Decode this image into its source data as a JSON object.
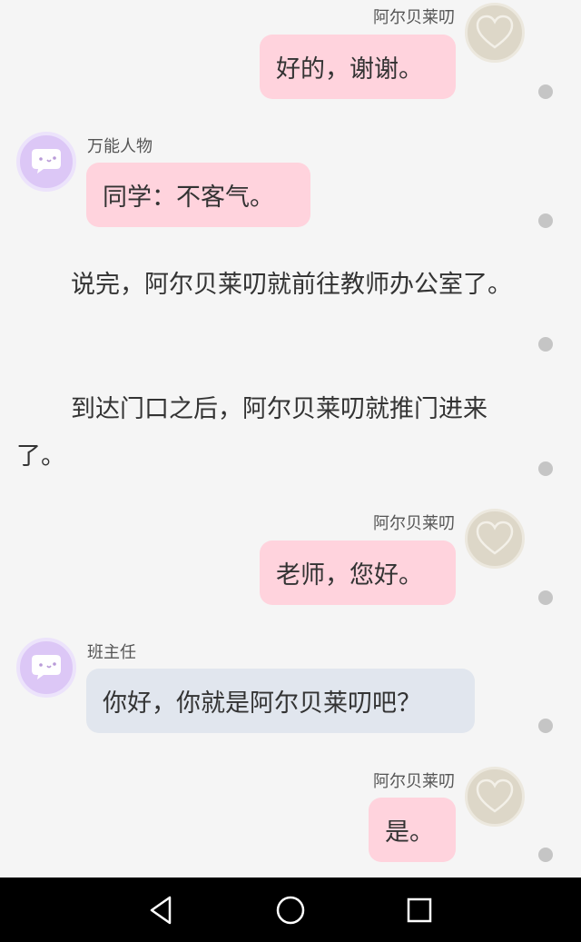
{
  "chat": {
    "msg1": {
      "name": "阿尔贝莱叨",
      "text": "好的，谢谢。",
      "avatar_icon": "heart-avatar-icon"
    },
    "msg2": {
      "name": "万能人物",
      "text": "同学：不客气。",
      "avatar_icon": "chat-bubble-avatar-icon"
    },
    "narration1": "说完，阿尔贝莱叨就前往教师办公室了。",
    "narration2": "到达门口之后，阿尔贝莱叨就推门进来了。",
    "msg3": {
      "name": "阿尔贝莱叨",
      "text": "老师，您好。",
      "avatar_icon": "heart-avatar-icon"
    },
    "msg4": {
      "name": "班主任",
      "text": "你好，你就是阿尔贝莱叨吧？",
      "avatar_icon": "chat-bubble-avatar-icon"
    },
    "msg5": {
      "name": "阿尔贝莱叨",
      "text": "是。",
      "avatar_icon": "heart-avatar-icon"
    }
  },
  "navbar": {
    "back": "back-triangle-icon",
    "home": "home-circle-icon",
    "recents": "recents-square-icon"
  },
  "colors": {
    "user_bubble": "#ffd3dd",
    "bot_bubble_1": "#ffd3dd",
    "bot_bubble_2": "#e1e6ee",
    "bot_avatar": "#dcc7f6",
    "background": "#f5f5f5"
  }
}
